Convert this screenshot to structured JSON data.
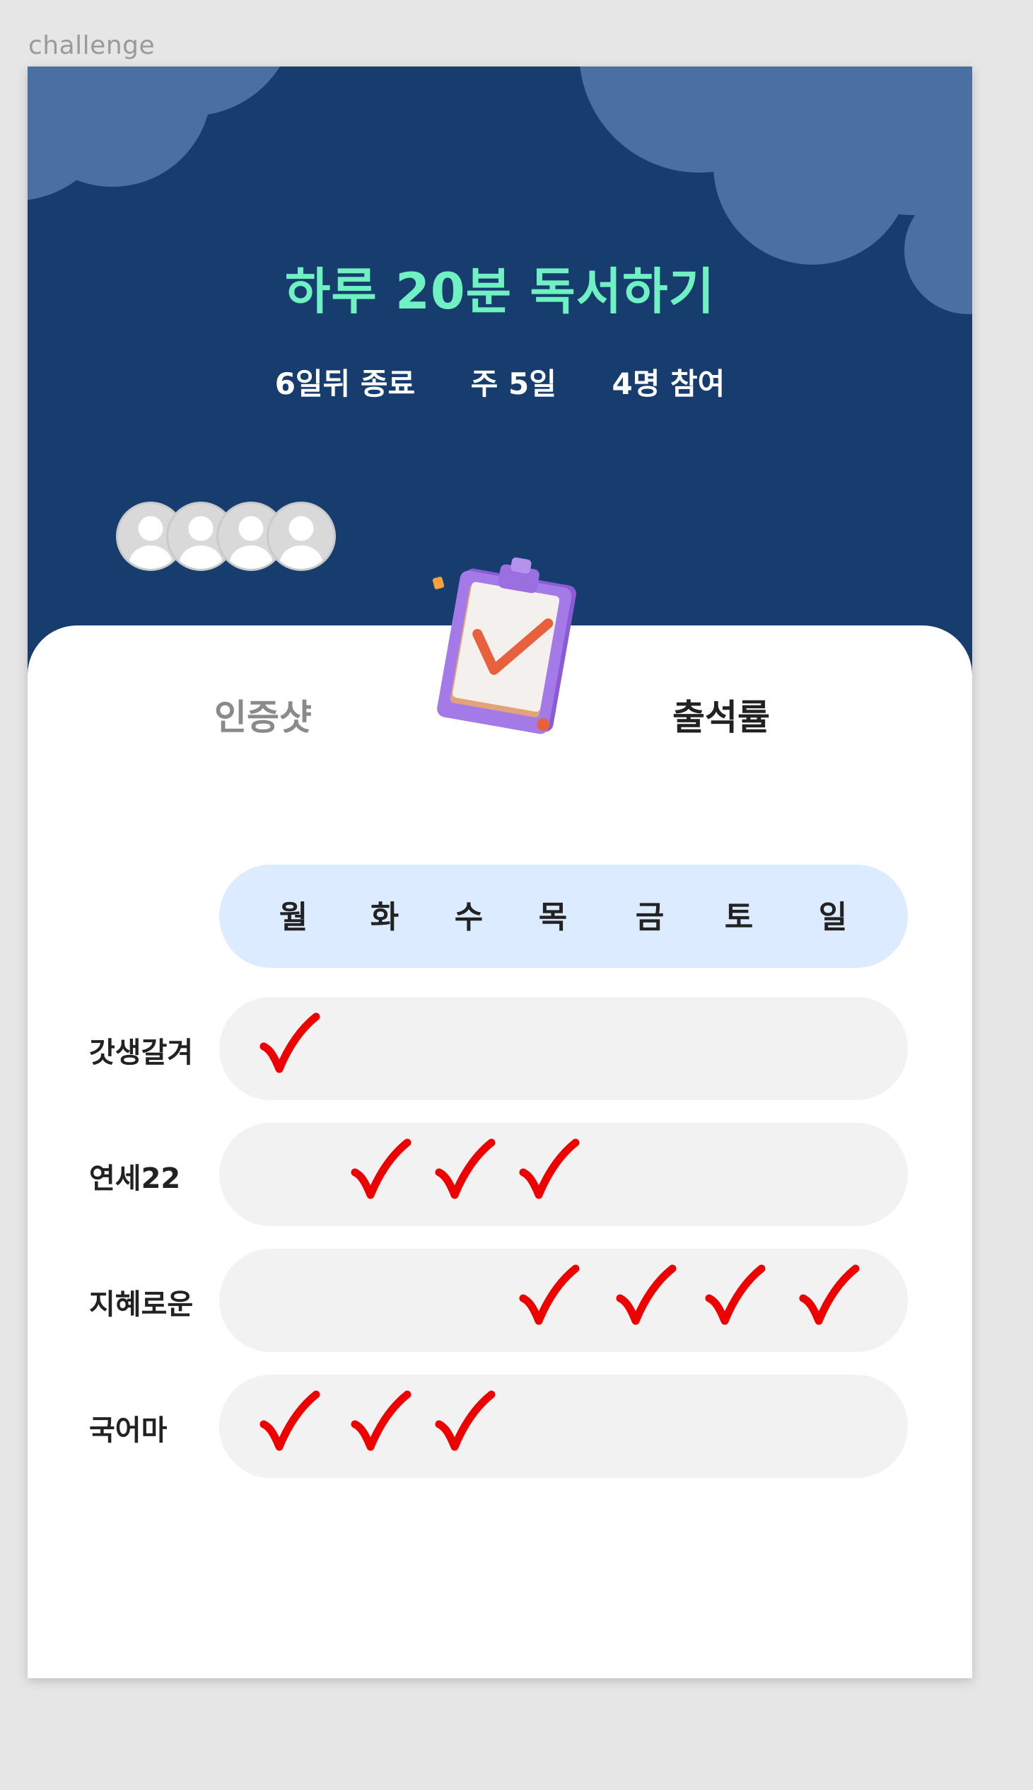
{
  "frame_label": "challenge",
  "challenge": {
    "title": "하루 20분 독서하기",
    "ends_in": "6일뒤 종료",
    "frequency": "주 5일",
    "participants": "4명 참여"
  },
  "avatars": [
    "avatar",
    "avatar",
    "avatar",
    "avatar"
  ],
  "tabs": {
    "proof_label": "인증샷",
    "attendance_label": "출석률",
    "active": "attendance"
  },
  "days": [
    "월",
    "화",
    "수",
    "목",
    "금",
    "토",
    "일"
  ],
  "attendance": [
    {
      "name": "갓생갈겨",
      "checks": [
        true,
        false,
        false,
        false,
        false,
        false,
        false
      ]
    },
    {
      "name": "연세22",
      "checks": [
        false,
        true,
        true,
        true,
        false,
        false,
        false
      ]
    },
    {
      "name": "지혜로운",
      "checks": [
        false,
        false,
        false,
        true,
        true,
        true,
        true
      ]
    },
    {
      "name": "국어마",
      "checks": [
        true,
        true,
        true,
        false,
        false,
        false,
        false
      ]
    }
  ],
  "colors": {
    "hero_bg": "#173d6f",
    "cloud": "#4a6fa3",
    "title": "#6ff1c2",
    "days_bar": "#dcebff",
    "row_bar": "#f2f2f2",
    "check": "#ee0000"
  }
}
